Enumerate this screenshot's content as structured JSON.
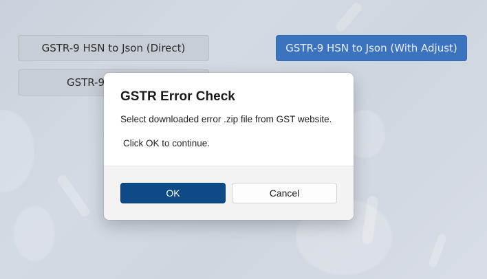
{
  "background_buttons": {
    "hsn_direct_label": "GSTR-9 HSN to Json (Direct)",
    "hsn_adjust_label": "GSTR-9 HSN to Json (With Adjust)",
    "partial_label": "GSTR-9"
  },
  "dialog": {
    "title": "GSTR Error Check",
    "message_line1": "Select downloaded error .zip file from GST website.",
    "message_line2": "Click OK to continue.",
    "ok_label": "OK",
    "cancel_label": "Cancel"
  },
  "colors": {
    "accent_button": "#3c73bf",
    "ok_button": "#0d4a86"
  }
}
